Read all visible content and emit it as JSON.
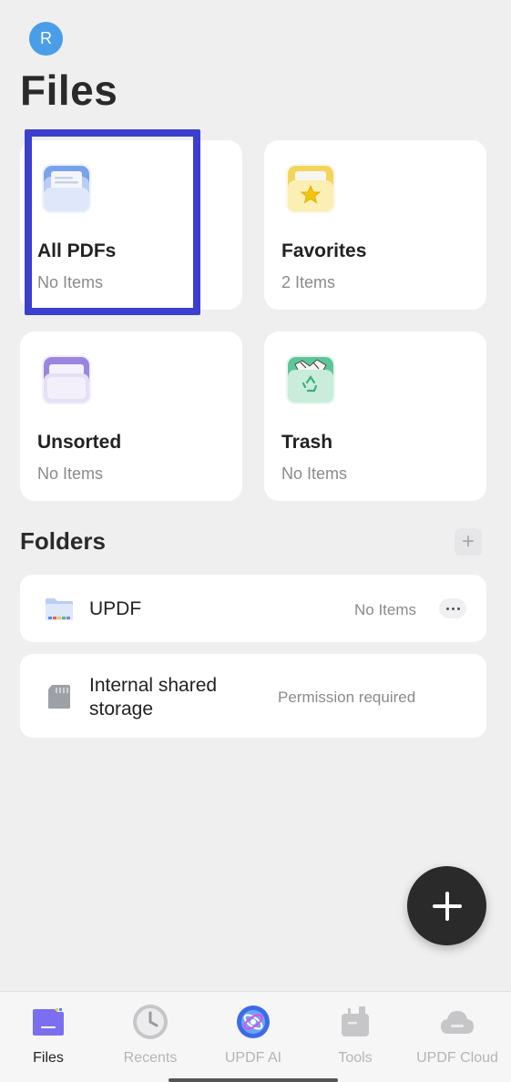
{
  "profile": {
    "initial": "R"
  },
  "page": {
    "title": "Files"
  },
  "cards": [
    {
      "title": "All PDFs",
      "count": "No Items",
      "icon": "all-pdfs-icon"
    },
    {
      "title": "Favorites",
      "count": "2 Items",
      "icon": "favorites-icon"
    },
    {
      "title": "Unsorted",
      "count": "No Items",
      "icon": "unsorted-icon"
    },
    {
      "title": "Trash",
      "count": "No Items",
      "icon": "trash-icon"
    }
  ],
  "folders": {
    "title": "Folders",
    "add_icon": "plus-icon",
    "items": [
      {
        "name": "UPDF",
        "status": "No Items",
        "icon": "folder-icon",
        "more_icon": "more-icon"
      },
      {
        "name": "Internal shared storage",
        "status": "Permission required",
        "icon": "sd-card-icon"
      }
    ]
  },
  "fab": {
    "icon": "plus-icon"
  },
  "bottom_nav": [
    {
      "label": "Files",
      "icon": "files-icon",
      "active": true
    },
    {
      "label": "Recents",
      "icon": "clock-icon",
      "active": false
    },
    {
      "label": "UPDF AI",
      "icon": "updf-ai-icon",
      "active": false
    },
    {
      "label": "Tools",
      "icon": "tools-icon",
      "active": false
    },
    {
      "label": "UPDF Cloud",
      "icon": "cloud-icon",
      "active": false
    }
  ],
  "colors": {
    "background": "#efeff0",
    "card": "#ffffff",
    "avatar": "#4a9ee8",
    "highlight": "#3b3fd0",
    "fab": "#2a2a2a",
    "nav_active": "#222222",
    "nav_inactive": "#b5b5b5"
  }
}
